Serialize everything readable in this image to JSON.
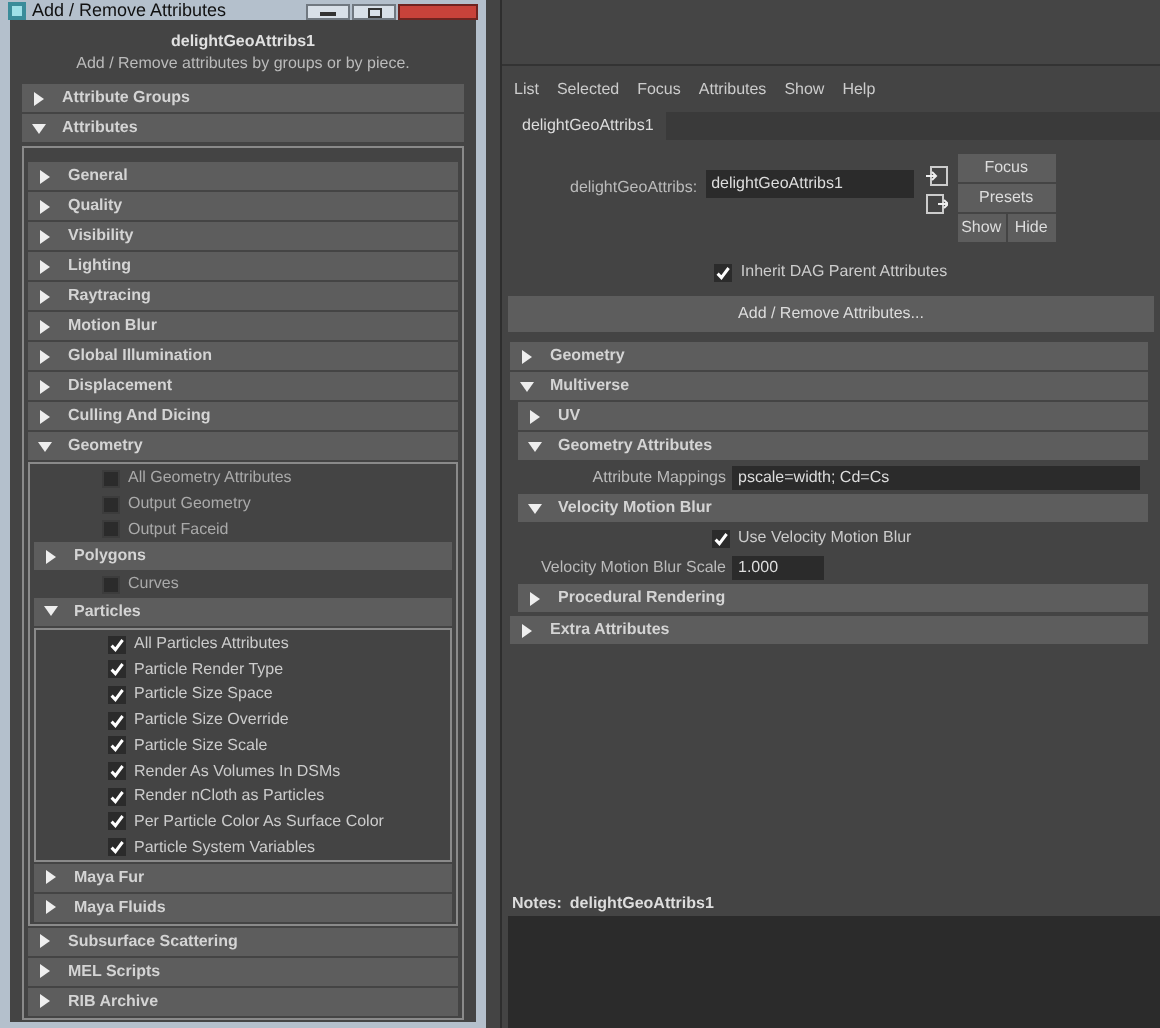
{
  "dialog": {
    "title": "Add / Remove Attributes",
    "node": "delightGeoAttribs1",
    "subtitle": "Add / Remove attributes by groups or by piece.",
    "sections": [
      {
        "kind": "frame",
        "label": "Attribute Groups",
        "expanded": false
      },
      {
        "kind": "frame",
        "label": "Attributes",
        "expanded": true,
        "children": [
          {
            "kind": "frame",
            "label": "General",
            "expanded": false
          },
          {
            "kind": "frame",
            "label": "Quality",
            "expanded": false
          },
          {
            "kind": "frame",
            "label": "Visibility",
            "expanded": false
          },
          {
            "kind": "frame",
            "label": "Lighting",
            "expanded": false
          },
          {
            "kind": "frame",
            "label": "Raytracing",
            "expanded": false
          },
          {
            "kind": "frame",
            "label": "Motion Blur",
            "expanded": false
          },
          {
            "kind": "frame",
            "label": "Global Illumination",
            "expanded": false
          },
          {
            "kind": "frame",
            "label": "Displacement",
            "expanded": false
          },
          {
            "kind": "frame",
            "label": "Culling And Dicing",
            "expanded": false
          },
          {
            "kind": "frame",
            "label": "Geometry",
            "expanded": true,
            "children": [
              {
                "kind": "checkbox",
                "label": "All Geometry Attributes",
                "checked": false
              },
              {
                "kind": "checkbox",
                "label": "Output Geometry",
                "checked": false
              },
              {
                "kind": "checkbox",
                "label": "Output Faceid",
                "checked": false
              },
              {
                "kind": "frame",
                "label": "Polygons",
                "expanded": false
              },
              {
                "kind": "checkbox",
                "label": "Curves",
                "checked": false
              },
              {
                "kind": "frame",
                "label": "Particles",
                "expanded": true,
                "children": [
                  {
                    "kind": "checkbox",
                    "label": "All Particles Attributes",
                    "checked": true
                  },
                  {
                    "kind": "checkbox",
                    "label": "Particle Render Type",
                    "checked": true
                  },
                  {
                    "kind": "checkbox",
                    "label": "Particle Size Space",
                    "checked": true
                  },
                  {
                    "kind": "checkbox",
                    "label": "Particle Size Override",
                    "checked": true
                  },
                  {
                    "kind": "checkbox",
                    "label": "Particle Size Scale",
                    "checked": true
                  },
                  {
                    "kind": "checkbox",
                    "label": "Render As Volumes In DSMs",
                    "checked": true
                  },
                  {
                    "kind": "checkbox",
                    "label": "Render nCloth as Particles",
                    "checked": true
                  },
                  {
                    "kind": "checkbox",
                    "label": "Per Particle Color As Surface Color",
                    "checked": true
                  },
                  {
                    "kind": "checkbox",
                    "label": "Particle System Variables",
                    "checked": true
                  }
                ]
              },
              {
                "kind": "frame",
                "label": "Maya Fur",
                "expanded": false
              },
              {
                "kind": "frame",
                "label": "Maya Fluids",
                "expanded": false
              }
            ]
          },
          {
            "kind": "frame",
            "label": "Subsurface Scattering",
            "expanded": false
          },
          {
            "kind": "frame",
            "label": "MEL Scripts",
            "expanded": false
          },
          {
            "kind": "frame",
            "label": "RIB Archive",
            "expanded": false
          }
        ]
      }
    ]
  },
  "editor": {
    "menu": [
      "List",
      "Selected",
      "Focus",
      "Attributes",
      "Show",
      "Help"
    ],
    "tabs": [
      {
        "label": "delightGeoAttribs1",
        "selected": true
      }
    ],
    "node_field": {
      "label": "delightGeoAttribs:",
      "value": "delightGeoAttribs1"
    },
    "buttons": [
      "Focus",
      "Presets",
      "Show",
      "Hide"
    ],
    "inherit": {
      "label": "Inherit DAG Parent Attributes",
      "checked": true
    },
    "add_remove_button": "Add / Remove Attributes...",
    "frames": [
      {
        "kind": "frame",
        "label": "Geometry",
        "expanded": false
      },
      {
        "kind": "frame",
        "label": "Multiverse",
        "expanded": true,
        "children": [
          {
            "kind": "frame",
            "label": "UV",
            "expanded": false
          },
          {
            "kind": "frame",
            "label": "Geometry Attributes",
            "expanded": true,
            "children": [
              {
                "kind": "field",
                "label": "Attribute Mappings",
                "value": "pscale=width; Cd=Cs",
                "wide": true
              }
            ]
          },
          {
            "kind": "frame",
            "label": "Velocity Motion Blur",
            "expanded": true,
            "children": [
              {
                "kind": "checkbox",
                "label": "Use Velocity Motion Blur",
                "checked": true
              },
              {
                "kind": "field",
                "label": "Velocity Motion Blur Scale",
                "value": "1.000",
                "wide": false
              }
            ]
          },
          {
            "kind": "frame",
            "label": "Procedural Rendering",
            "expanded": false
          }
        ]
      },
      {
        "kind": "frame",
        "label": "Extra Attributes",
        "expanded": false
      }
    ],
    "notes": {
      "label": "Notes:",
      "node": "delightGeoAttribs1"
    }
  }
}
